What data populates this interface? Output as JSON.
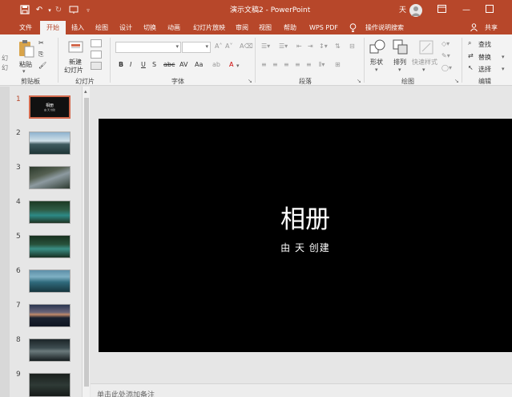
{
  "titlebar": {
    "doc_title": "演示文稿2 - PowerPoint",
    "user_initial": "天",
    "colors": {
      "accent": "#b7472a"
    }
  },
  "tabs": [
    "文件",
    "开始",
    "插入",
    "绘图",
    "设计",
    "切换",
    "动画",
    "幻灯片放映",
    "审阅",
    "视图",
    "帮助",
    "WPS PDF"
  ],
  "active_tab": "开始",
  "tellme": "操作说明搜索",
  "share": "共享",
  "ribbon": {
    "clipboard": {
      "paste": "粘贴",
      "label": "剪贴板"
    },
    "slides": {
      "new_line1": "新建",
      "new_line2": "幻灯片",
      "label": "幻灯片"
    },
    "font": {
      "label": "字体"
    },
    "paragraph": {
      "label": "段落"
    },
    "drawing": {
      "shape": "形状",
      "arrange": "排列",
      "quickstyle": "快速样式",
      "label": "绘图"
    },
    "editing": {
      "find": "查找",
      "replace": "替换",
      "select": "选择",
      "label": "编辑"
    },
    "left_cut": "幻",
    "left_cut2": "幻"
  },
  "thumbnails": [
    "1",
    "2",
    "3",
    "4",
    "5",
    "6",
    "7",
    "8",
    "9"
  ],
  "thumb1": {
    "title": "相册",
    "sub": "由 天 创建"
  },
  "slide": {
    "title": "相册",
    "subtitle": "由 天 创建"
  },
  "notes": "单击此处添加备注"
}
